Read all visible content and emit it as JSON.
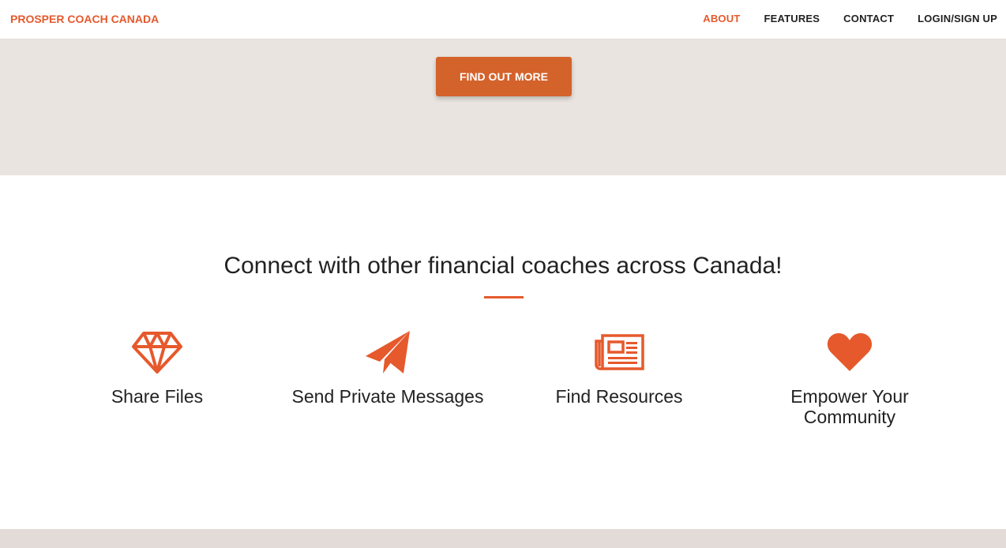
{
  "navbar": {
    "brand": "PROSPER COACH CANADA",
    "links": [
      {
        "label": "ABOUT",
        "active": true
      },
      {
        "label": "FEATURES",
        "active": false
      },
      {
        "label": "CONTACT",
        "active": false
      },
      {
        "label": "LOGIN/SIGN UP",
        "active": false
      }
    ]
  },
  "hero": {
    "cta_label": "FIND OUT MORE"
  },
  "services": {
    "heading": "Connect with other financial coaches across Canada!",
    "features": [
      {
        "icon": "diamond-icon",
        "label": "Share Files"
      },
      {
        "icon": "paper-plane-icon",
        "label": "Send Private Messages"
      },
      {
        "icon": "newspaper-icon",
        "label": "Find Resources"
      },
      {
        "icon": "heart-icon",
        "label": "Empower Your Community"
      }
    ]
  },
  "colors": {
    "accent": "#e6592c",
    "button": "#d4622b",
    "hero_bg": "#e9e4e0",
    "text": "#222222"
  }
}
